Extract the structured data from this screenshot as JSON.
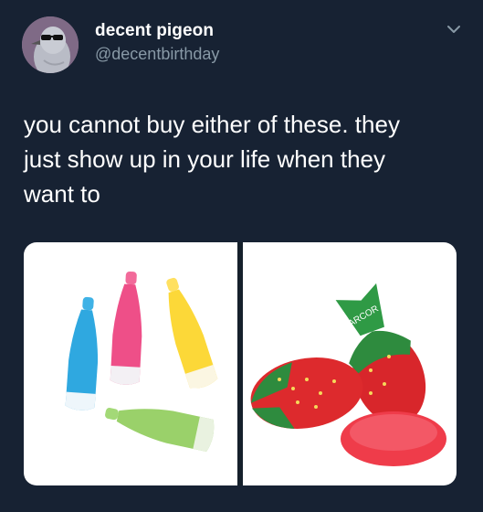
{
  "author": {
    "display_name": "decent pigeon",
    "handle": "@decentbirthday",
    "avatar_icon": "pigeon-with-sunglasses-avatar"
  },
  "tweet": {
    "text": "you cannot buy either of these. they\njust show up in your life when they\nwant to"
  },
  "menu": {
    "icon": "chevron-down-icon"
  },
  "media": {
    "images": [
      {
        "subject": "gummy-soda-bottle-candies"
      },
      {
        "subject": "strawberry-hard-candies",
        "wrapper_text": "ARCOR"
      }
    ]
  },
  "colors": {
    "background": "#172233",
    "text_primary": "#ffffff",
    "text_secondary": "#8899a6"
  }
}
